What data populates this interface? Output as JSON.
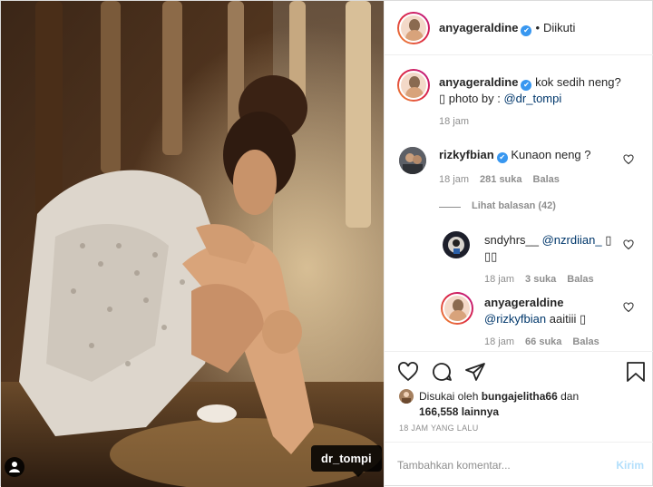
{
  "photo": {
    "tagged_user": "dr_tompi"
  },
  "header": {
    "username": "anyageraldine",
    "verified_mark": "✔",
    "separator": "•",
    "follow_status": "Diikuti"
  },
  "caption": {
    "username": "anyageraldine",
    "verified_mark": "✔",
    "text": "kok sedih neng?",
    "line2_prefix": "▯ photo by : ",
    "line2_mention": "@dr_tompi",
    "time": "18 jam"
  },
  "comments": [
    {
      "username": "rizkyfbian",
      "verified_mark": "✔",
      "text": "Kunaon neng ?",
      "time": "18 jam",
      "likes": "281 suka",
      "reply": "Balas",
      "view_replies": "Lihat balasan (42)"
    }
  ],
  "replies": [
    {
      "username": "sndyhrs__",
      "mention": "@nzrdiian_",
      "trail": "▯",
      "line2": "▯▯",
      "time": "18 jam",
      "likes": "3 suka",
      "reply": "Balas"
    },
    {
      "username": "anyageraldine",
      "mention": "@rizkyfbian",
      "text": "aaitiii ▯",
      "time": "18 jam",
      "likes": "66 suka",
      "reply": "Balas"
    }
  ],
  "actions": {
    "like_icon": "heart-icon",
    "comment_icon": "comment-icon",
    "share_icon": "share-icon",
    "save_icon": "bookmark-icon"
  },
  "likes": {
    "prefix": "Disukai oleh",
    "user": "bungajelitha66",
    "joiner": "dan",
    "others": "166,558 lainnya"
  },
  "time_ago": "18 JAM YANG LALU",
  "comment_input": {
    "placeholder": "Tambahkan komentar...",
    "post_label": "Kirim"
  }
}
